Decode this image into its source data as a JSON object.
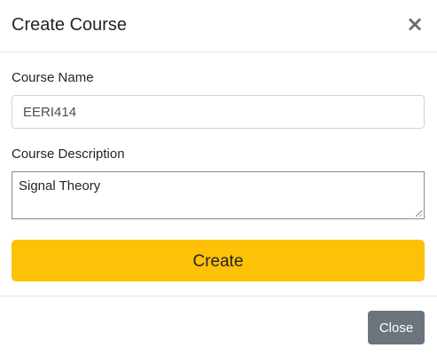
{
  "modal": {
    "title": "Create Course",
    "close_icon": "close-icon",
    "close_glyph": "×"
  },
  "form": {
    "course_name": {
      "label": "Course Name",
      "value": "EERI414"
    },
    "course_description": {
      "label": "Course Description",
      "value": "Signal Theory"
    },
    "create_label": "Create"
  },
  "footer": {
    "close_label": "Close"
  },
  "colors": {
    "create_button": "#ffc107",
    "close_button": "#6c757d",
    "border": "#dee2e6"
  }
}
